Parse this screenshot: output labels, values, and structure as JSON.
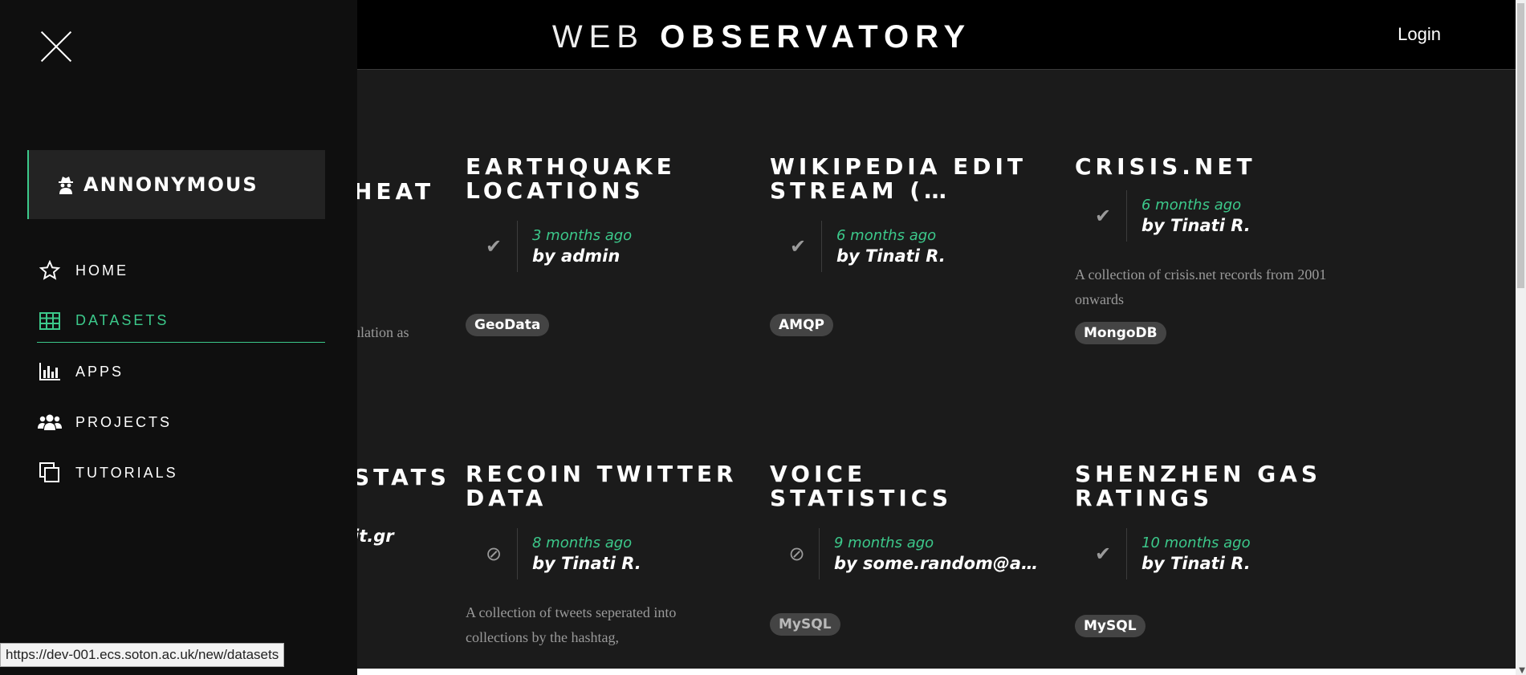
{
  "header": {
    "brand_light": "WEB",
    "brand_bold": "OBSERVATORY",
    "login_label": "Login"
  },
  "sidebar": {
    "user": "ANNONYMOUS",
    "items": [
      {
        "label": "HOME",
        "icon": "star-icon"
      },
      {
        "label": "DATASETS",
        "icon": "table-icon",
        "active": true
      },
      {
        "label": "APPS",
        "icon": "bar-chart-icon"
      },
      {
        "label": "PROJECTS",
        "icon": "users-icon"
      },
      {
        "label": "TUTORIALS",
        "icon": "copy-icon"
      }
    ]
  },
  "partial": {
    "row1_title": "HEAT",
    "row1_desc": "ulation as",
    "row2_title": "STATS",
    "row2_author": "it.gr"
  },
  "cards": [
    {
      "title": "EARTHQUAKE LOCATIONS",
      "status": "check",
      "age": "3 months ago",
      "author": "by admin",
      "desc": "",
      "tag": "GeoData"
    },
    {
      "title": "WIKIPEDIA EDIT STREAM (…",
      "status": "check",
      "age": "6 months ago",
      "author": "by Tinati R.",
      "desc": "",
      "tag": "AMQP"
    },
    {
      "title": "CRISIS.NET",
      "status": "check",
      "age": "6 months ago",
      "author": "by Tinati R.",
      "desc": "A collection of crisis.net records from 2001 onwards",
      "tag": "MongoDB"
    },
    {
      "title": "RECOIN TWITTER DATA",
      "status": "ban",
      "age": "8 months ago",
      "author": "by Tinati R.",
      "desc": "A collection of tweets seperated into collections by the hashtag,",
      "tag": ""
    },
    {
      "title": "VOICE STATISTICS",
      "status": "ban",
      "age": "9 months ago",
      "author": "by some.random@ad…",
      "desc": "",
      "tag": "MySQL"
    },
    {
      "title": "SHENZHEN GAS RATINGS",
      "status": "check",
      "age": "10 months ago",
      "author": "by Tinati R.",
      "desc": "",
      "tag": "MySQL"
    }
  ],
  "status_url": "https://dev-001.ecs.soton.ac.uk/new/datasets"
}
